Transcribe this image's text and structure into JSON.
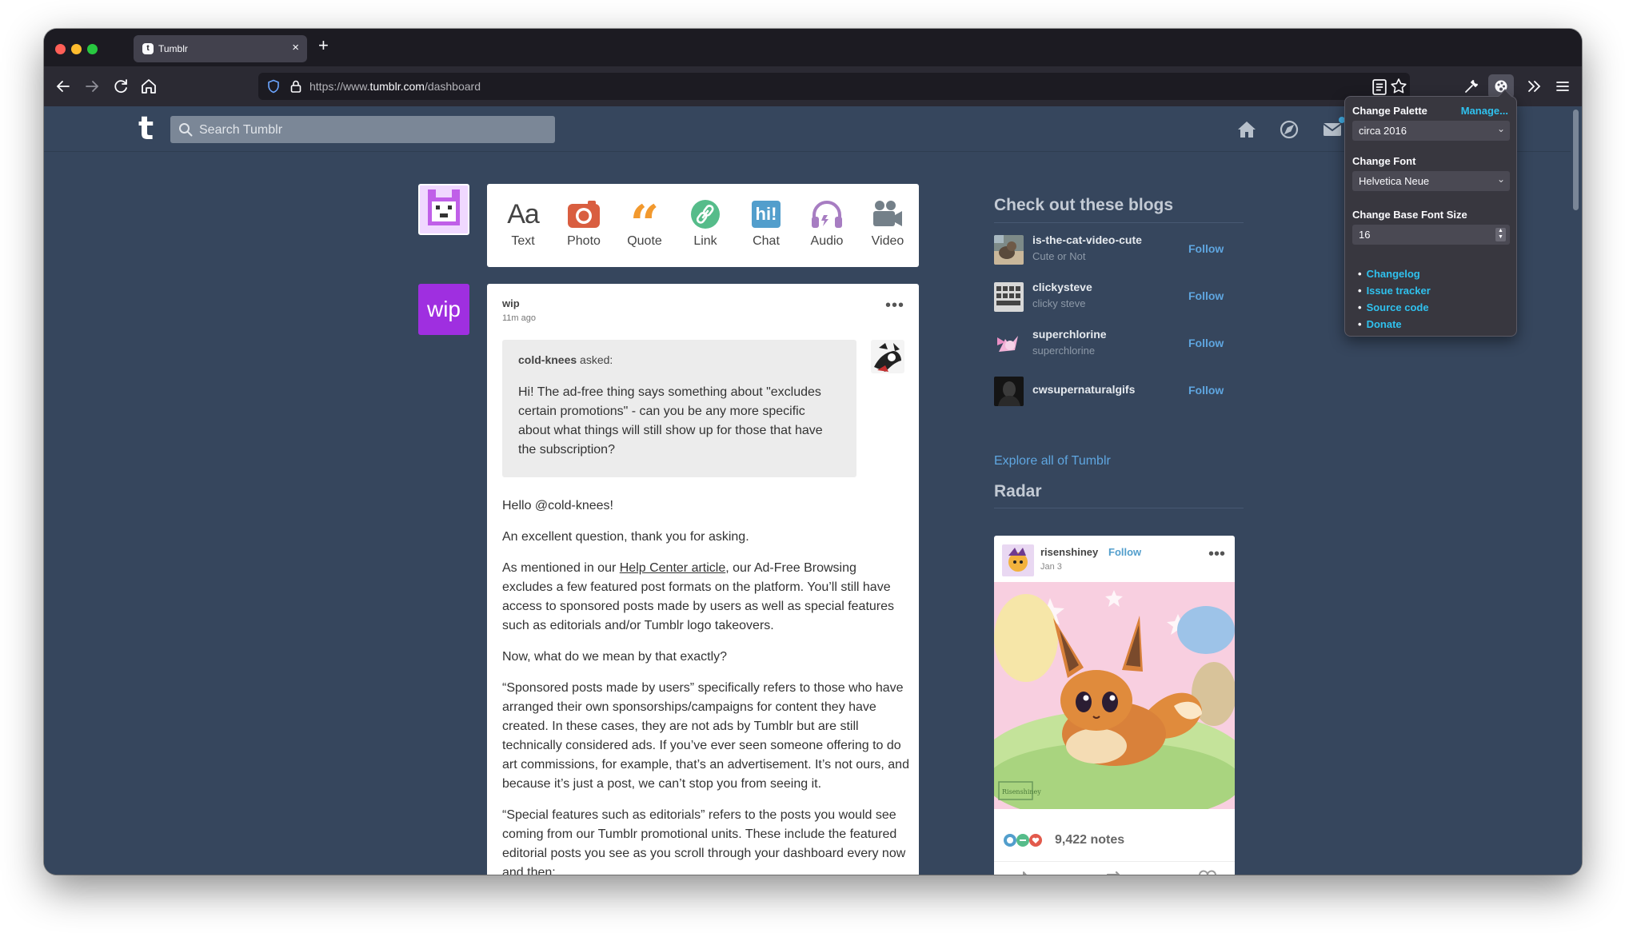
{
  "browser": {
    "tab_title": "Tumblr",
    "tab_favicon": "t",
    "close_glyph": "×",
    "new_tab_glyph": "+",
    "url_prefix": "https://www.",
    "url_domain": "tumblr.com",
    "url_path": "/dashboard"
  },
  "tumblr": {
    "logo": "t",
    "search_placeholder": "Search Tumblr",
    "composer": [
      {
        "label": "Text",
        "icon": "text-icon",
        "glyph": "Aa",
        "color": "#444444"
      },
      {
        "label": "Photo",
        "icon": "camera-icon",
        "color": "#d95e40"
      },
      {
        "label": "Quote",
        "icon": "quote-icon",
        "color": "#f2992e"
      },
      {
        "label": "Link",
        "icon": "link-icon",
        "color": "#56bc8a"
      },
      {
        "label": "Chat",
        "icon": "chat-icon",
        "glyph": "hi!",
        "color": "#529ecc"
      },
      {
        "label": "Audio",
        "icon": "headphones-icon",
        "color": "#a77dc2"
      },
      {
        "label": "Video",
        "icon": "video-camera-icon",
        "color": "#748089"
      }
    ],
    "composer_avatar_color": "#c05fe8",
    "post": {
      "avatar_text": "wip",
      "avatar_color": "#9f2fe0",
      "blog": "wip",
      "time": "11m ago",
      "menu_glyph": "•••",
      "asker": "cold-knees",
      "asked_suffix": " asked:",
      "question": "Hi! The ad-free thing says something about \"excludes certain promotions\" - can you be any more specific about what things will still show up for those that have the subscription?",
      "paragraphs": {
        "p1": "Hello @cold-knees!",
        "p2": "An excellent question, thank you for asking.",
        "p3_before": "As mentioned in our ",
        "p3_link": "Help Center article",
        "p3_after": ", our Ad-Free Browsing excludes a few featured post formats on the platform. You’ll still have access to sponsored posts made by users as well as special features such as editorials and/or Tumblr logo takeovers.",
        "p4": "Now, what do we mean by that exactly?",
        "p5": "“Sponsored posts made by users” specifically refers to those who have arranged their own sponsorships/campaigns for content they have created. In these cases, they are not ads by Tumblr but are still technically considered ads. If you’ve ever seen someone offering to do art commissions, for example, that’s an advertisement. It’s not ours, and because it’s just a post, we can’t stop you from seeing it.",
        "p6": "“Special features such as editorials” refers to the posts you would see coming from our Tumblr promotional units. These include the featured editorial posts you see as you scroll through your dashboard every now and then:"
      }
    },
    "sidebar": {
      "blogs_heading": "Check out these blogs",
      "follow_label": "Follow",
      "blogs": [
        {
          "name": "is-the-cat-video-cute",
          "subtitle": "Cute or Not"
        },
        {
          "name": "clickysteve",
          "subtitle": "clicky steve"
        },
        {
          "name": "superchlorine",
          "subtitle": "superchlorine"
        },
        {
          "name": "cwsupernaturalgifs",
          "subtitle": ""
        }
      ],
      "explore_link": "Explore all of Tumblr",
      "radar_heading": "Radar",
      "radar": {
        "blog": "risenshiney",
        "follow_label": "Follow",
        "date": "Jan 3",
        "menu_glyph": "•••",
        "notes": "9,422 notes",
        "image_signature": "Risenshiney"
      }
    }
  },
  "extension_popup": {
    "palette_label": "Change Palette",
    "manage_link": "Manage...",
    "palette_value": "circa 2016",
    "font_label": "Change Font",
    "font_value": "Helvetica Neue",
    "size_label": "Change Base Font Size",
    "size_value": "16",
    "chevron": "⌄",
    "links": [
      "Changelog",
      "Issue tracker",
      "Source code",
      "Donate"
    ]
  }
}
